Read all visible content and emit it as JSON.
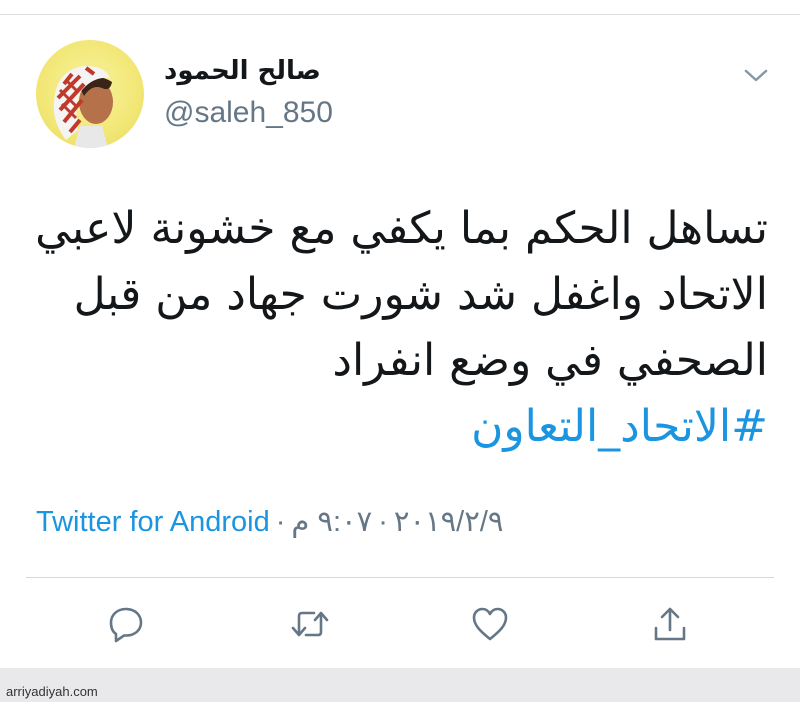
{
  "tweet": {
    "display_name": "صالح الحمود",
    "handle": "@saleh_850",
    "lines": [
      "تساهل الحكم بما يكفي مع خشونة لاعبي",
      "الاتحاد واغفل شد شورت جهاد من قبل",
      "الصحفي في وضع انفراد"
    ],
    "hashtag": "#الاتحاد_التعاون",
    "source": "Twitter for Android",
    "separator": "·",
    "date": "٢٠١٩/٢/٩",
    "time": "٩:٠٧ م"
  },
  "icons": {
    "menu": "chevron-down-icon",
    "reply": "reply-icon",
    "retweet": "retweet-icon",
    "like": "heart-icon",
    "share": "share-icon"
  },
  "colors": {
    "link": "#1b95e0",
    "secondary": "#657786",
    "text": "#14171a",
    "avatar_background": "#f2e776"
  },
  "watermark": "arriyadiyah.com"
}
